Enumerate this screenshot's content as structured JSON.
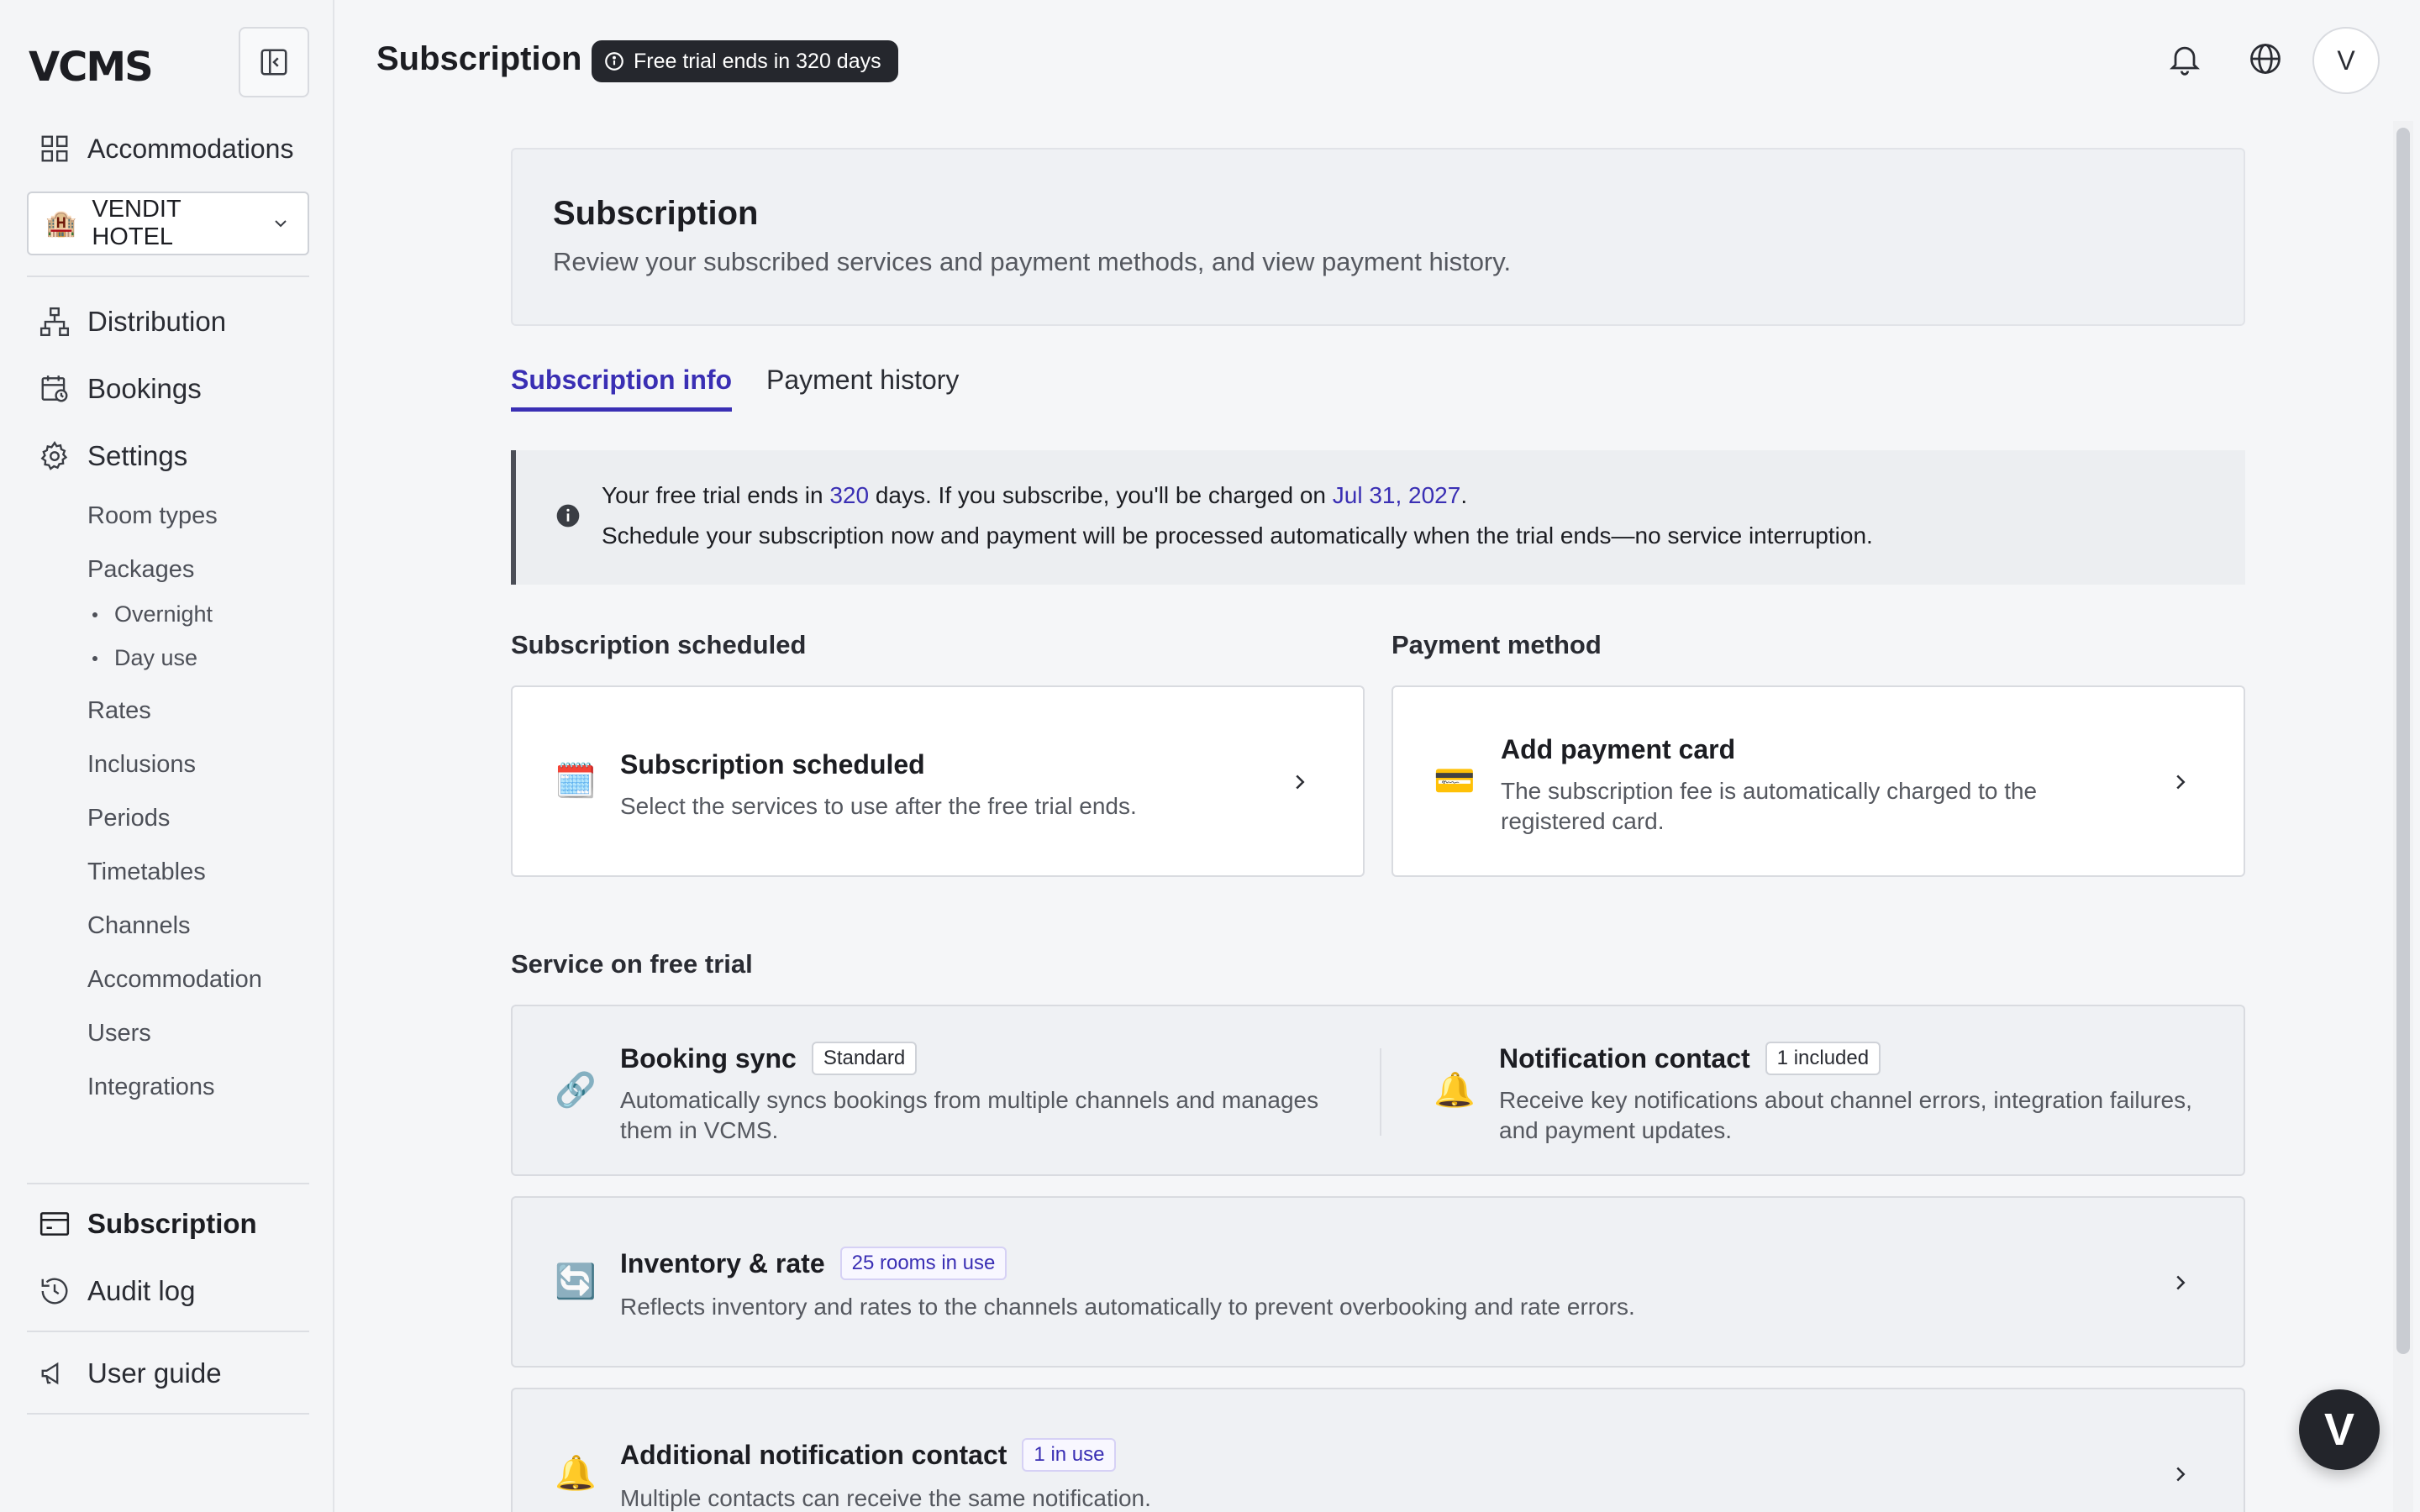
{
  "app": {
    "logo": "VCMS"
  },
  "sidebar": {
    "top_item": "Accommodations",
    "hotel": "VENDIT HOTEL",
    "nav": [
      "Distribution",
      "Bookings",
      "Settings"
    ],
    "settings_items": [
      "Room types",
      "Packages",
      "Rates",
      "Inclusions",
      "Periods",
      "Timetables",
      "Channels",
      "Accommodation",
      "Users",
      "Integrations"
    ],
    "package_items": [
      "Overnight",
      "Day use"
    ],
    "bottom": [
      "Subscription",
      "Audit log"
    ],
    "guide": "User guide"
  },
  "header": {
    "title": "Subscription",
    "trial_badge": "Free trial ends in 320 days",
    "avatar": "V"
  },
  "hero": {
    "title": "Subscription",
    "description": "Review your subscribed services and payment methods, and view payment history."
  },
  "tabs": [
    "Subscription info",
    "Payment history"
  ],
  "notice": {
    "p1": "Your free trial ends in ",
    "days": "320",
    "p2": " days. If you subscribe, you'll be charged on ",
    "date": "Jul 31, 2027",
    "p3": ".",
    "line2": "Schedule your subscription now and payment will be processed automatically when the trial ends—no service interruption."
  },
  "sections": {
    "scheduled": "Subscription scheduled",
    "payment": "Payment method",
    "free_trial": "Service on free trial"
  },
  "cards": {
    "scheduled": {
      "icon": "calendar-icon",
      "title": "Subscription scheduled",
      "desc": "Select the services to use after the free trial ends."
    },
    "payment": {
      "icon": "credit-card-icon",
      "title": "Add payment card",
      "desc1": "The subscription fee is automatically charged to the",
      "desc2": "registered card."
    },
    "booking_sync": {
      "icon": "link-icon",
      "title": "Booking sync",
      "tag": "Standard",
      "desc1": "Automatically syncs bookings from multiple channels and manages",
      "desc2": "them in VCMS."
    },
    "notification": {
      "icon": "bell-icon",
      "title": "Notification contact",
      "tag": "1 included",
      "desc1": "Receive key notifications about channel errors, integration failures,",
      "desc2": "and payment updates."
    },
    "inventory": {
      "icon": "refresh-icon",
      "title": "Inventory & rate",
      "tag": "25 rooms in use",
      "desc": "Reflects inventory and rates to the channels automatically to prevent overbooking and rate errors."
    },
    "additional": {
      "icon": "bell-icon",
      "title": "Additional notification contact",
      "tag": "1 in use",
      "desc": "Multiple contacts can receive the same notification."
    }
  },
  "fab": "V",
  "colors": {
    "accent": "#3a2fb4",
    "badge_bg": "#25272d"
  }
}
